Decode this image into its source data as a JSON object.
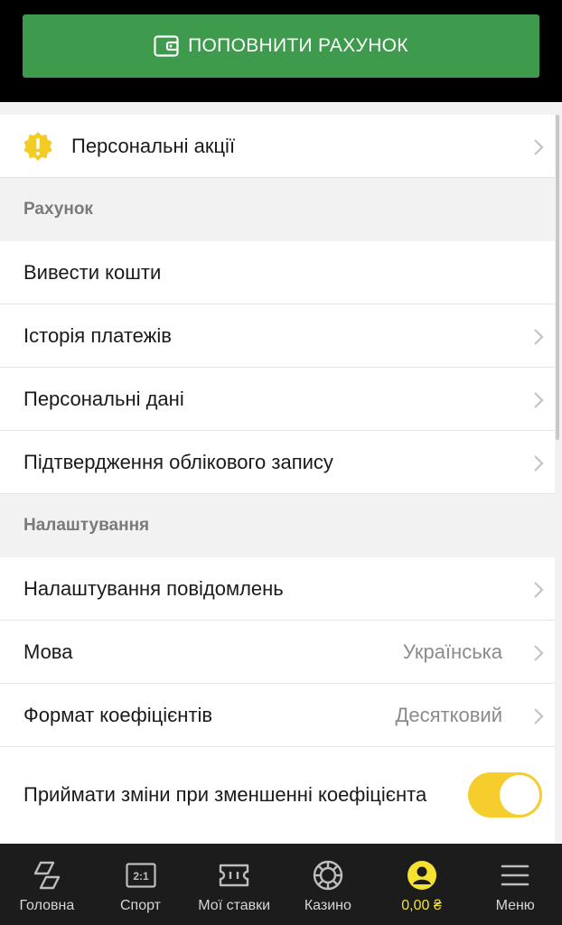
{
  "header": {
    "deposit_label": "ПОПОВНИТИ РАХУНОК",
    "button_color": "#3e9a4c"
  },
  "promo": {
    "label": "Персональні акції",
    "icon": "exclamation-badge-icon"
  },
  "account_section": {
    "title": "Рахунок",
    "items": [
      {
        "label": "Вивести кошти"
      },
      {
        "label": "Історія платежів"
      },
      {
        "label": "Персональні дані"
      },
      {
        "label": "Підтвердження облікового запису"
      }
    ]
  },
  "settings_section": {
    "title": "Налаштування",
    "items": [
      {
        "label": "Налаштування повідомлень"
      },
      {
        "label": "Мова",
        "value": "Українська"
      },
      {
        "label": "Формат коефіцієнтів",
        "value": "Десятковий"
      }
    ],
    "toggle": {
      "label": "Приймати зміни при зменшенні коефіцієнта",
      "on": true,
      "color": "#f5cd2d"
    }
  },
  "tabbar": {
    "tabs": [
      {
        "label": "Головна",
        "icon": "home-logo-icon"
      },
      {
        "label": "Спорт",
        "icon": "scoreboard-icon"
      },
      {
        "label": "Мої ставки",
        "icon": "ticket-icon"
      },
      {
        "label": "Казино",
        "icon": "casino-chip-icon"
      },
      {
        "label": "0,00 ₴",
        "icon": "user-avatar-icon",
        "active": true
      },
      {
        "label": "Меню",
        "icon": "hamburger-icon"
      }
    ],
    "active_color": "#f5e130"
  }
}
